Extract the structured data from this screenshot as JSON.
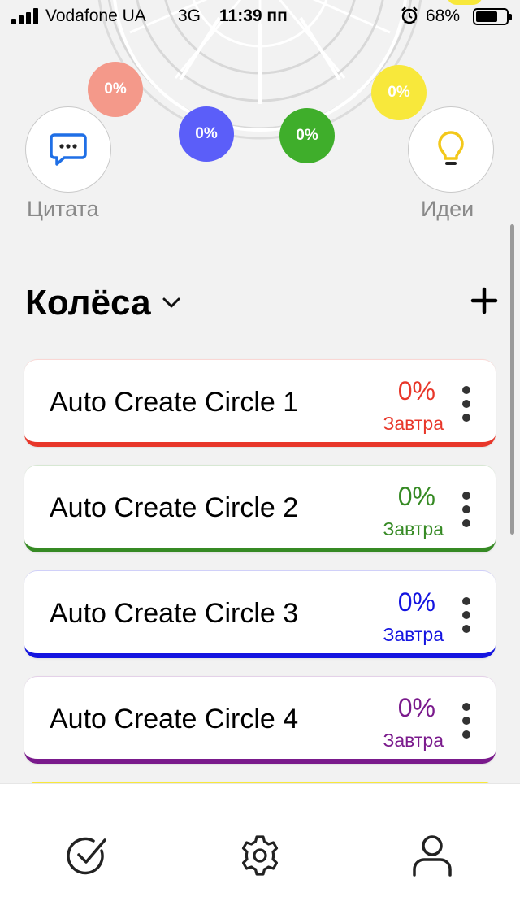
{
  "status_bar": {
    "carrier": "Vodafone UA",
    "network": "3G",
    "time": "11:39 пп",
    "battery_percent": "68%",
    "signal_icon": "signal-bars-icon",
    "alarm_icon": "alarm-clock-icon",
    "battery_icon": "battery-icon"
  },
  "wheel": {
    "segments": [
      {
        "label": "0%",
        "color": "#f4998a"
      },
      {
        "label": "0%",
        "color": "#5b5ef9"
      },
      {
        "label": "0%",
        "color": "#3fae2b"
      },
      {
        "label": "0%",
        "color": "#f8e83b"
      }
    ],
    "partial_colors": [
      "#e85a3a",
      "#f8e83b"
    ]
  },
  "quick_actions": {
    "quote": {
      "label": "Цитата",
      "icon": "message-dots-icon"
    },
    "ideas": {
      "label": "Идеи",
      "icon": "lightbulb-icon"
    }
  },
  "section": {
    "title": "Колёса",
    "dropdown_icon": "chevron-down-icon",
    "add_icon": "plus-icon"
  },
  "wheels": [
    {
      "name": "Auto Create Circle 1",
      "percent": "0%",
      "due": "Завтра",
      "color": "#e8372a"
    },
    {
      "name": "Auto Create Circle 2",
      "percent": "0%",
      "due": "Завтра",
      "color": "#368a24"
    },
    {
      "name": "Auto Create Circle 3",
      "percent": "0%",
      "due": "Завтра",
      "color": "#1414e0"
    },
    {
      "name": "Auto Create Circle 4",
      "percent": "0%",
      "due": "Завтра",
      "color": "#7a1a8c"
    }
  ],
  "bottom_nav": [
    {
      "icon": "check-circle-icon"
    },
    {
      "icon": "gear-icon"
    },
    {
      "icon": "user-icon"
    }
  ]
}
